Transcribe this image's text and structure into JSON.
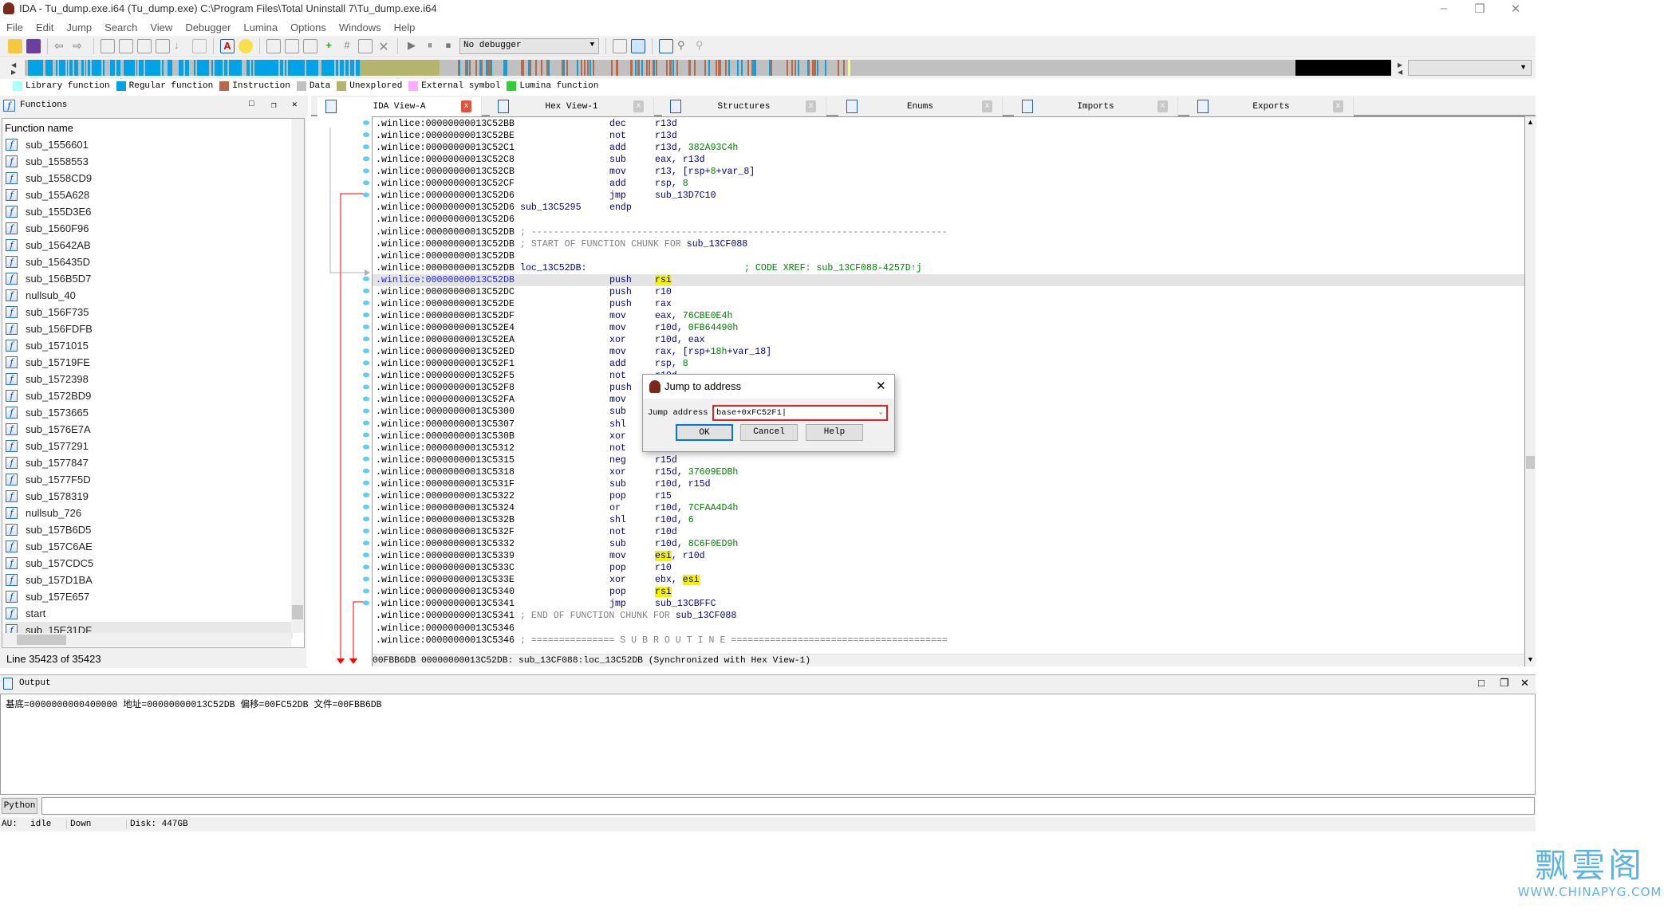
{
  "window": {
    "title": "IDA - Tu_dump.exe.i64 (Tu_dump.exe) C:\\Program Files\\Total Uninstall 7\\Tu_dump.exe.i64"
  },
  "menu": [
    "File",
    "Edit",
    "Jump",
    "Search",
    "View",
    "Debugger",
    "Lumina",
    "Options",
    "Windows",
    "Help"
  ],
  "toolbar": {
    "debugger_select": "No debugger"
  },
  "legend": [
    {
      "label": "Library function",
      "color": "#aaffff"
    },
    {
      "label": "Regular function",
      "color": "#00a2e8"
    },
    {
      "label": "Instruction",
      "color": "#b9694a"
    },
    {
      "label": "Data",
      "color": "#c0c0c0"
    },
    {
      "label": "Unexplored",
      "color": "#b4b46c"
    },
    {
      "label": "External symbol",
      "color": "#ffaaff"
    },
    {
      "label": "Lumina function",
      "color": "#32cd32"
    }
  ],
  "functions_panel": {
    "title": "Functions",
    "column": "Function name",
    "items": [
      "sub_1556601",
      "sub_1558553",
      "sub_1558CD9",
      "sub_155A628",
      "sub_155D3E6",
      "sub_1560F96",
      "sub_15642AB",
      "sub_156435D",
      "sub_156B5D7",
      "nullsub_40",
      "sub_156F735",
      "sub_156FDFB",
      "sub_1571015",
      "sub_15719FE",
      "sub_1572398",
      "sub_1572BD9",
      "sub_1573665",
      "sub_1576E7A",
      "sub_1577291",
      "sub_1577847",
      "sub_1577F5D",
      "sub_1578319",
      "nullsub_726",
      "sub_157B6D5",
      "sub_157C6AE",
      "sub_157CDC5",
      "sub_157D1BA",
      "sub_157E657",
      "start",
      "sub_15E31DF"
    ],
    "status": "Line 35423 of 35423"
  },
  "tabs": [
    {
      "label": "IDA View-A",
      "active": true
    },
    {
      "label": "Hex View-1"
    },
    {
      "label": "Structures"
    },
    {
      "label": "Enums"
    },
    {
      "label": "Imports"
    },
    {
      "label": "Exports"
    }
  ],
  "disasm": {
    "lines": [
      {
        "a": ".winlice:00000000013C52BB",
        "m": "dec",
        "o": [
          [
            "r13d",
            ""
          ]
        ]
      },
      {
        "a": ".winlice:00000000013C52BE",
        "m": "not",
        "o": [
          [
            "r13d",
            ""
          ]
        ]
      },
      {
        "a": ".winlice:00000000013C52C1",
        "m": "add",
        "o": [
          [
            "r13d, ",
            ""
          ],
          [
            "382A93C4h",
            "n"
          ]
        ]
      },
      {
        "a": ".winlice:00000000013C52C8",
        "m": "sub",
        "o": [
          [
            "eax, r13d",
            ""
          ]
        ]
      },
      {
        "a": ".winlice:00000000013C52CB",
        "m": "mov",
        "o": [
          [
            "r13, [rsp+",
            ""
          ],
          [
            "8",
            "n"
          ],
          [
            "+var_8]",
            ""
          ]
        ]
      },
      {
        "a": ".winlice:00000000013C52CF",
        "m": "add",
        "o": [
          [
            "rsp, ",
            ""
          ],
          [
            "8",
            "n"
          ]
        ]
      },
      {
        "a": ".winlice:00000000013C52D6",
        "m": "jmp",
        "o": [
          [
            "sub_13D7C10",
            ""
          ]
        ]
      },
      {
        "a": ".winlice:00000000013C52D6",
        "l": "sub_13C5295",
        "m": "endp",
        "o": []
      },
      {
        "a": ".winlice:00000000013C52D6",
        "o": []
      },
      {
        "a": ".winlice:00000000013C52DB",
        "l": "; ---------------------------------------------------------------------------",
        "lk": "c",
        "o": []
      },
      {
        "a": ".winlice:00000000013C52DB",
        "o": [],
        "l2": [
          [
            "; START OF FUNCTION CHUNK FOR ",
            "c"
          ],
          [
            "sub_13CF088",
            ""
          ]
        ]
      },
      {
        "a": ".winlice:00000000013C52DB",
        "o": []
      },
      {
        "a": ".winlice:00000000013C52DB",
        "l": "loc_13C52DB:",
        "xref": "; CODE XREF: sub_13CF088-4257D↑j",
        "o": []
      },
      {
        "a": ".winlice:00000000013C52DB",
        "m": "push",
        "o": [
          [
            "rsi",
            "h"
          ]
        ],
        "cur": true
      },
      {
        "a": ".winlice:00000000013C52DC",
        "m": "push",
        "o": [
          [
            "r10",
            ""
          ]
        ]
      },
      {
        "a": ".winlice:00000000013C52DE",
        "m": "push",
        "o": [
          [
            "rax",
            ""
          ]
        ]
      },
      {
        "a": ".winlice:00000000013C52DF",
        "m": "mov",
        "o": [
          [
            "eax, ",
            ""
          ],
          [
            "76CBE0E4h",
            "n"
          ]
        ]
      },
      {
        "a": ".winlice:00000000013C52E4",
        "m": "mov",
        "o": [
          [
            "r10d, ",
            ""
          ],
          [
            "0FB64490h",
            "n"
          ]
        ]
      },
      {
        "a": ".winlice:00000000013C52EA",
        "m": "xor",
        "o": [
          [
            "r10d, eax",
            ""
          ]
        ]
      },
      {
        "a": ".winlice:00000000013C52ED",
        "m": "mov",
        "o": [
          [
            "rax, [rsp+",
            ""
          ],
          [
            "18h",
            "n"
          ],
          [
            "+var_18]",
            ""
          ]
        ]
      },
      {
        "a": ".winlice:00000000013C52F1",
        "m": "add",
        "o": [
          [
            "rsp, ",
            ""
          ],
          [
            "8",
            "n"
          ]
        ]
      },
      {
        "a": ".winlice:00000000013C52F5",
        "m": "not",
        "o": [
          [
            "r10d",
            ""
          ]
        ]
      },
      {
        "a": ".winlice:00000000013C52F8",
        "m": "push",
        "o": []
      },
      {
        "a": ".winlice:00000000013C52FA",
        "m": "mov",
        "o": []
      },
      {
        "a": ".winlice:00000000013C5300",
        "m": "sub",
        "o": []
      },
      {
        "a": ".winlice:00000000013C5307",
        "m": "shl",
        "o": []
      },
      {
        "a": ".winlice:00000000013C530B",
        "m": "xor",
        "o": []
      },
      {
        "a": ".winlice:00000000013C5312",
        "m": "not",
        "o": []
      },
      {
        "a": ".winlice:00000000013C5315",
        "m": "neg",
        "o": [
          [
            "r15d",
            ""
          ]
        ]
      },
      {
        "a": ".winlice:00000000013C5318",
        "m": "xor",
        "o": [
          [
            "r15d, ",
            ""
          ],
          [
            "37609EDBh",
            "n"
          ]
        ]
      },
      {
        "a": ".winlice:00000000013C531F",
        "m": "sub",
        "o": [
          [
            "r10d, r15d",
            ""
          ]
        ]
      },
      {
        "a": ".winlice:00000000013C5322",
        "m": "pop",
        "o": [
          [
            "r15",
            ""
          ]
        ]
      },
      {
        "a": ".winlice:00000000013C5324",
        "m": "or",
        "o": [
          [
            "r10d, ",
            ""
          ],
          [
            "7CFAA4D4h",
            "n"
          ]
        ]
      },
      {
        "a": ".winlice:00000000013C532B",
        "m": "shl",
        "o": [
          [
            "r10d, ",
            ""
          ],
          [
            "6",
            "n"
          ]
        ]
      },
      {
        "a": ".winlice:00000000013C532F",
        "m": "not",
        "o": [
          [
            "r10d",
            ""
          ]
        ]
      },
      {
        "a": ".winlice:00000000013C5332",
        "m": "sub",
        "o": [
          [
            "r10d, ",
            ""
          ],
          [
            "8C6F0ED9h",
            "n"
          ]
        ]
      },
      {
        "a": ".winlice:00000000013C5339",
        "m": "mov",
        "o": [
          [
            "esi",
            "h"
          ],
          [
            ", r10d",
            ""
          ]
        ]
      },
      {
        "a": ".winlice:00000000013C533C",
        "m": "pop",
        "o": [
          [
            "r10",
            ""
          ]
        ]
      },
      {
        "a": ".winlice:00000000013C533E",
        "m": "xor",
        "o": [
          [
            "ebx, ",
            ""
          ],
          [
            "esi",
            "h"
          ]
        ]
      },
      {
        "a": ".winlice:00000000013C5340",
        "m": "pop",
        "o": [
          [
            "rsi",
            "h"
          ]
        ]
      },
      {
        "a": ".winlice:00000000013C5341",
        "m": "jmp",
        "o": [
          [
            "sub_13CBFFC",
            ""
          ]
        ]
      },
      {
        "a": ".winlice:00000000013C5341",
        "o": [],
        "l2": [
          [
            "; END OF FUNCTION CHUNK FOR ",
            "c"
          ],
          [
            "sub_13CF088",
            ""
          ]
        ]
      },
      {
        "a": ".winlice:00000000013C5346",
        "o": []
      },
      {
        "a": ".winlice:00000000013C5346",
        "l": "; =============== S U B R O U T I N E =======================================",
        "lk": "c",
        "o": []
      }
    ],
    "status": "00FBB6DB 00000000013C52DB: sub_13CF088:loc_13C52DB (Synchronized with Hex View-1)"
  },
  "dialog": {
    "title": "Jump to address",
    "field_label": "Jump address",
    "field_value": "base+0xFC52F1",
    "ok": "OK",
    "cancel": "Cancel",
    "help": "Help"
  },
  "output": {
    "title": "Output",
    "text": "基底=0000000000400000 地址=00000000013C52DB 偏移=00FC52DB 文件=00FBB6DB",
    "python_button": "Python"
  },
  "statusbar": {
    "au": "AU:",
    "state": "idle",
    "direction": "Down",
    "disk": "Disk: 447GB"
  },
  "watermark": {
    "cn": "飘雲阁",
    "url": "WWW.CHINAPYG.COM"
  }
}
